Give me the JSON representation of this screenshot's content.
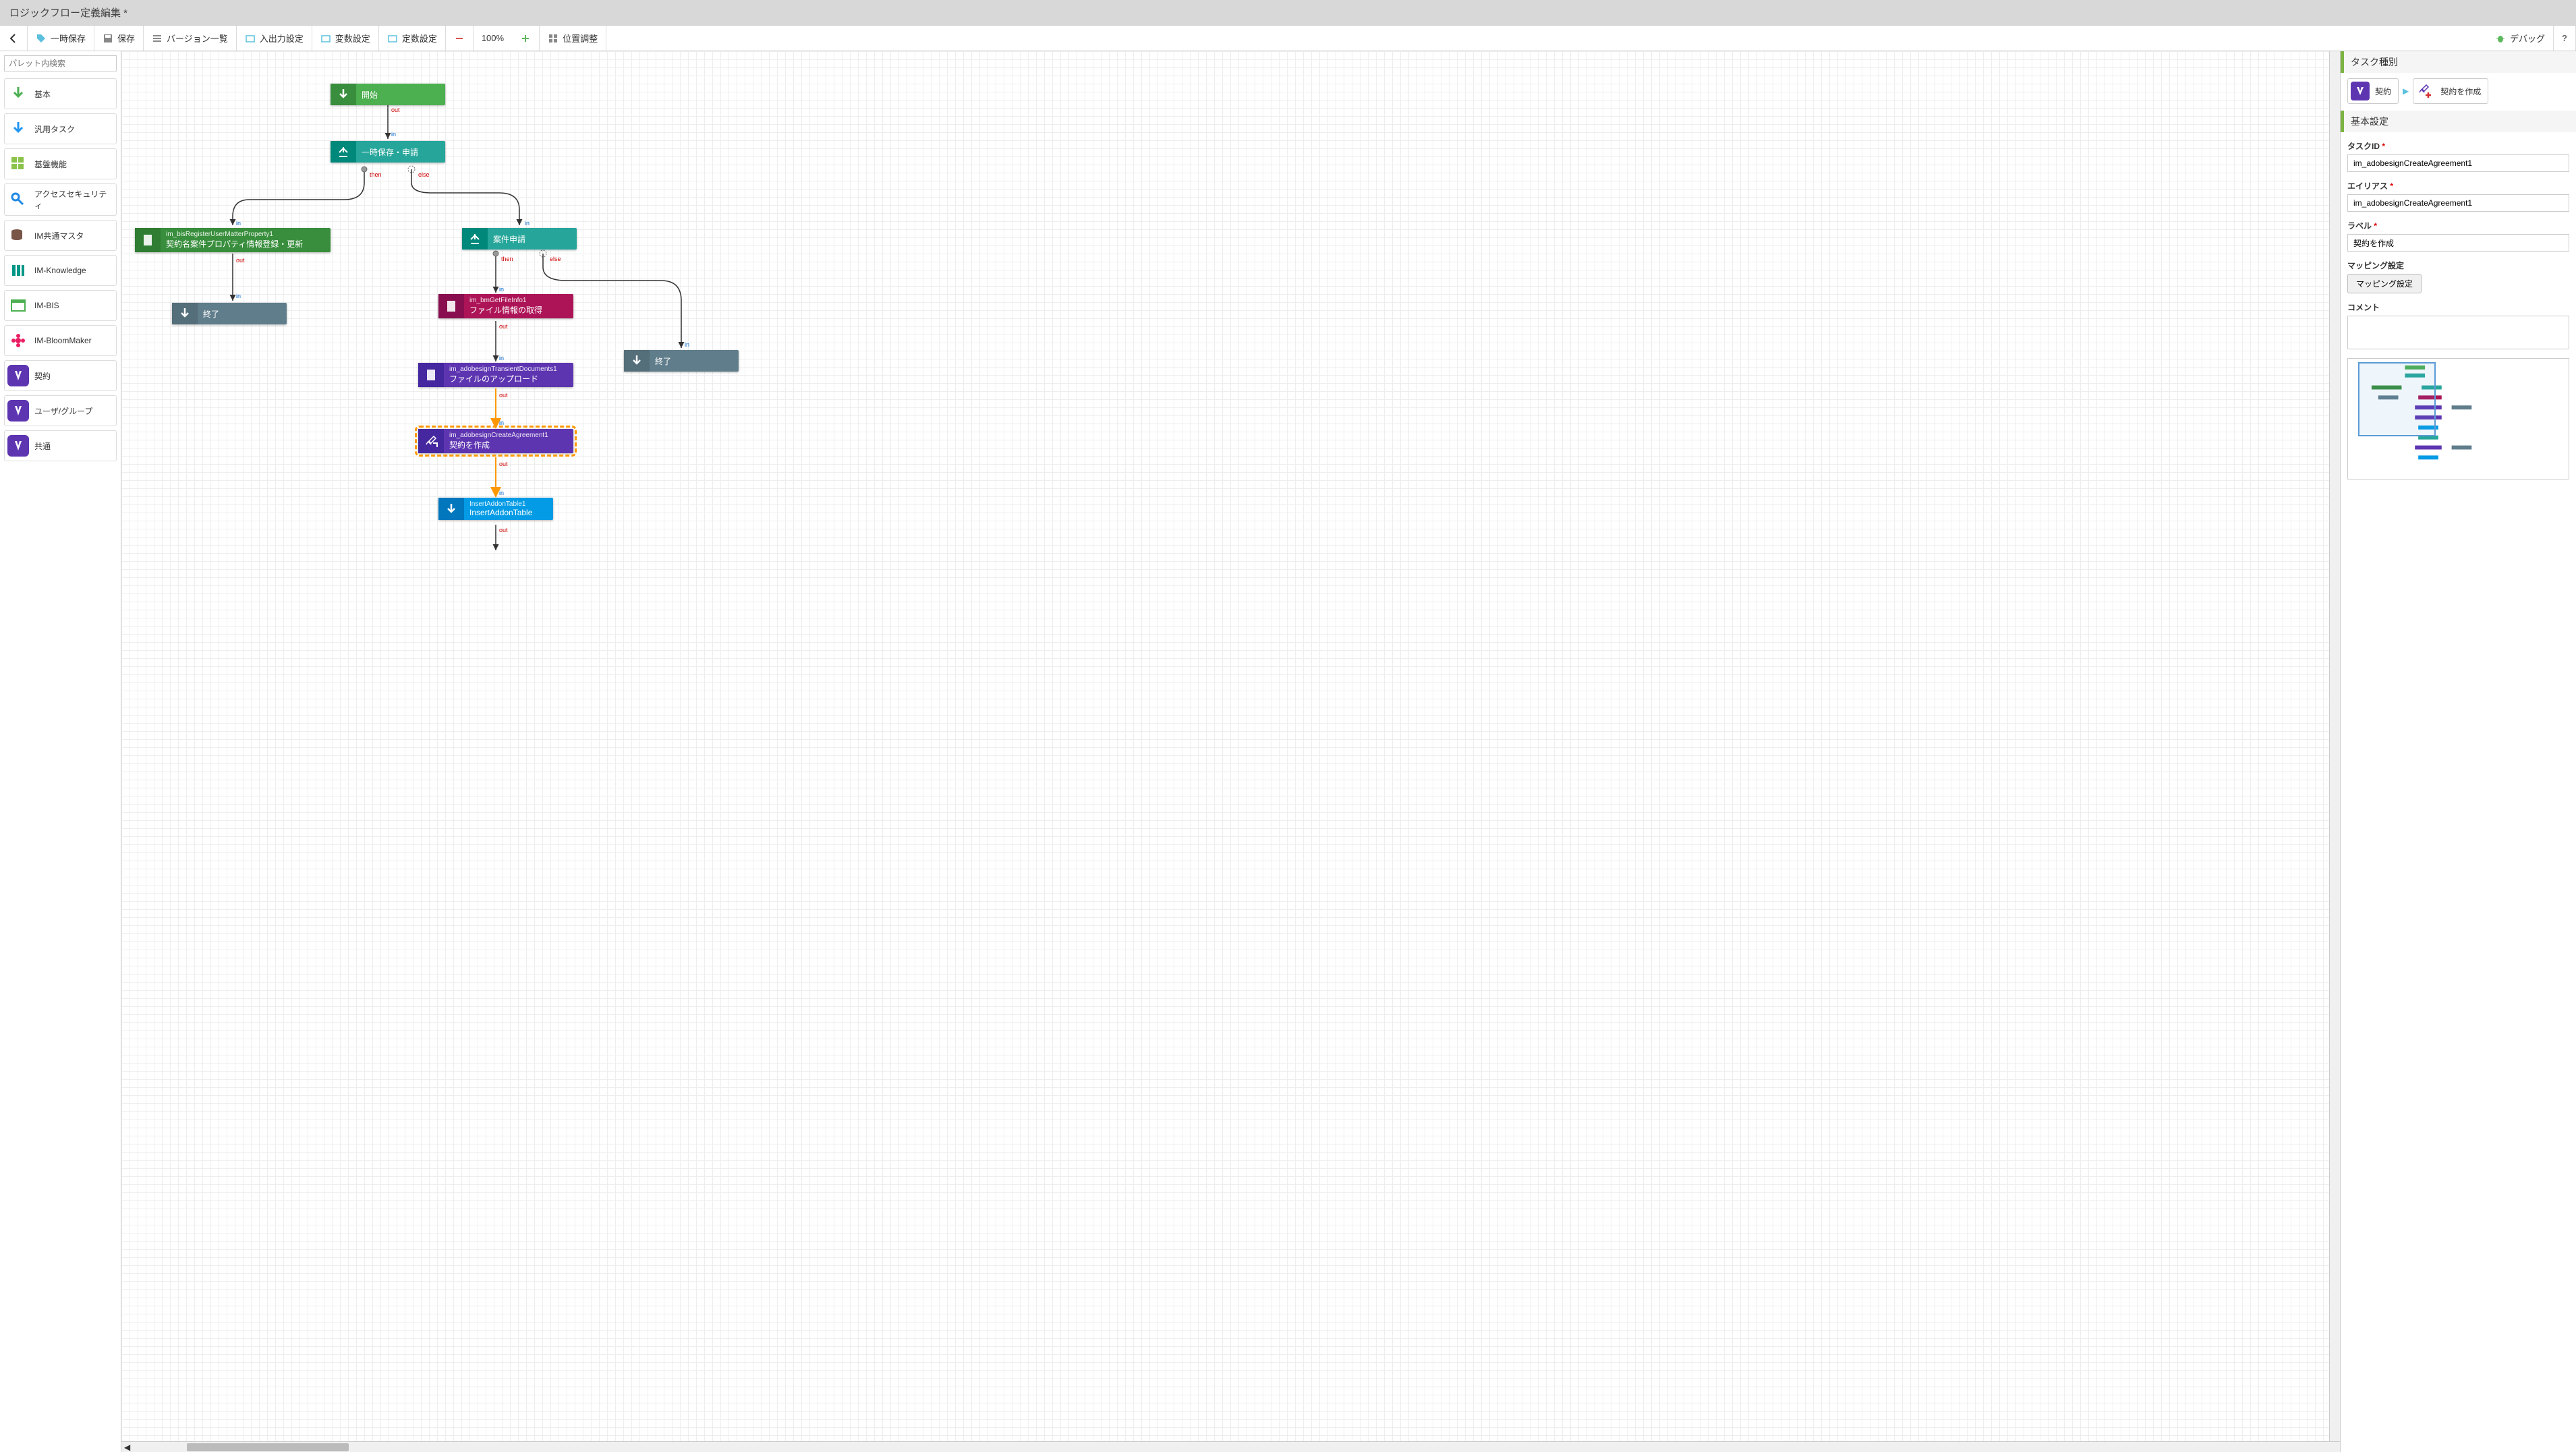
{
  "header": {
    "title": "ロジックフロー定義編集 *"
  },
  "toolbar": {
    "back": "",
    "tempSave": "一時保存",
    "save": "保存",
    "versionList": "バージョン一覧",
    "ioSettings": "入出力設定",
    "varSettings": "変数設定",
    "constSettings": "定数設定",
    "zoom": "100%",
    "positionAdjust": "位置調整",
    "debug": "デバッグ",
    "help": "?"
  },
  "palette": {
    "searchPlaceholder": "パレット内検索",
    "items": [
      {
        "label": "基本",
        "color": "#4caf50"
      },
      {
        "label": "汎用タスク",
        "color": "#2196f3"
      },
      {
        "label": "基盤機能",
        "color": "#8bc34a"
      },
      {
        "label": "アクセスセキュリティ",
        "color": "#1e88e5"
      },
      {
        "label": "IM共通マスタ",
        "color": "#795548"
      },
      {
        "label": "IM-Knowledge",
        "color": "#009688"
      },
      {
        "label": "IM-BIS",
        "color": "#4caf50"
      },
      {
        "label": "IM-BloomMaker",
        "color": "#e91e63"
      },
      {
        "label": "契約",
        "color": "#5e35b1"
      },
      {
        "label": "ユーザ/グループ",
        "color": "#5e35b1"
      },
      {
        "label": "共通",
        "color": "#5e35b1"
      }
    ]
  },
  "nodes": {
    "start": {
      "label": "開始"
    },
    "tempSaveApply": {
      "label": "一時保存・申請"
    },
    "bisRegister": {
      "title": "im_bisRegisterUserMatterProperty1",
      "label": "契約名案件プロパティ情報登録・更新"
    },
    "end1": {
      "label": "終了"
    },
    "caseApply": {
      "label": "案件申請"
    },
    "getFileInfo": {
      "title": "im_bmGetFileInfo1",
      "label": "ファイル情報の取得"
    },
    "transientDocs": {
      "title": "im_adobesignTransientDocuments1",
      "label": "ファイルのアップロード"
    },
    "createAgreement": {
      "title": "im_adobesignCreateAgreement1",
      "label": "契約を作成"
    },
    "insertAddon": {
      "title": "InsertAddonTable1",
      "label": "InsertAddonTable"
    },
    "end2": {
      "label": "終了"
    }
  },
  "ports": {
    "out": "out",
    "in": "in",
    "then": "then",
    "else": "else"
  },
  "sidebar": {
    "taskTypeTitle": "タスク種別",
    "typeBadge1": "契約",
    "typeBadge2": "契約を作成",
    "basicSettingsTitle": "基本設定",
    "taskIdLabel": "タスクID",
    "taskIdValue": "im_adobesignCreateAgreement1",
    "aliasLabel": "エイリアス",
    "aliasValue": "im_adobesignCreateAgreement1",
    "labelLabel": "ラベル",
    "labelValue": "契約を作成",
    "mappingTitle": "マッピング設定",
    "mappingBtn": "マッピング設定",
    "commentLabel": "コメント"
  }
}
